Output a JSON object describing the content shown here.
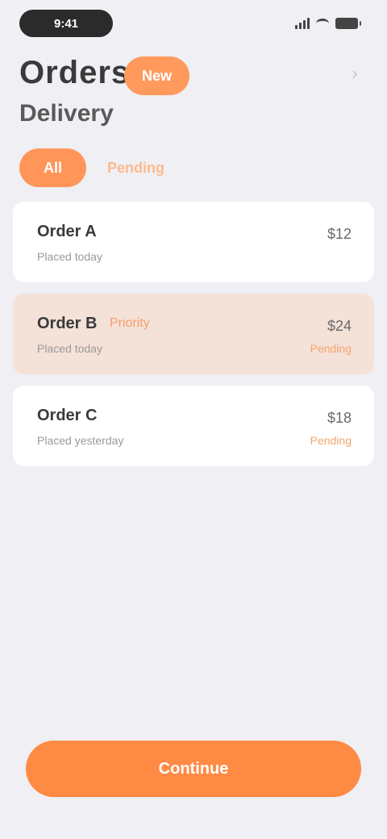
{
  "status_bar": {
    "time": "9:41",
    "icons": [
      "signal-icon",
      "wifi-icon",
      "battery-icon"
    ]
  },
  "header": {
    "title": "Orders",
    "badge": "New",
    "subtitle": "Delivery",
    "action_icon": "chevron-right-icon"
  },
  "filters": [
    {
      "label": "All",
      "active": true
    },
    {
      "label": "Pending",
      "active": false
    }
  ],
  "cards": [
    {
      "name": "Order A",
      "tag": "",
      "sub": "Placed today",
      "value": "$12",
      "note": ""
    },
    {
      "name": "Order B",
      "tag": "Priority",
      "sub": "Placed today",
      "value": "$24",
      "note": "Pending"
    },
    {
      "name": "Order C",
      "tag": "",
      "sub": "Placed yesterday",
      "value": "$18",
      "note": "Pending"
    }
  ],
  "cta": {
    "label": "Continue"
  },
  "colors": {
    "accent": "#ff8a44",
    "accent_light": "#ff9a5c",
    "highlight_card": "#f4e1d8",
    "background": "#efeff4"
  }
}
